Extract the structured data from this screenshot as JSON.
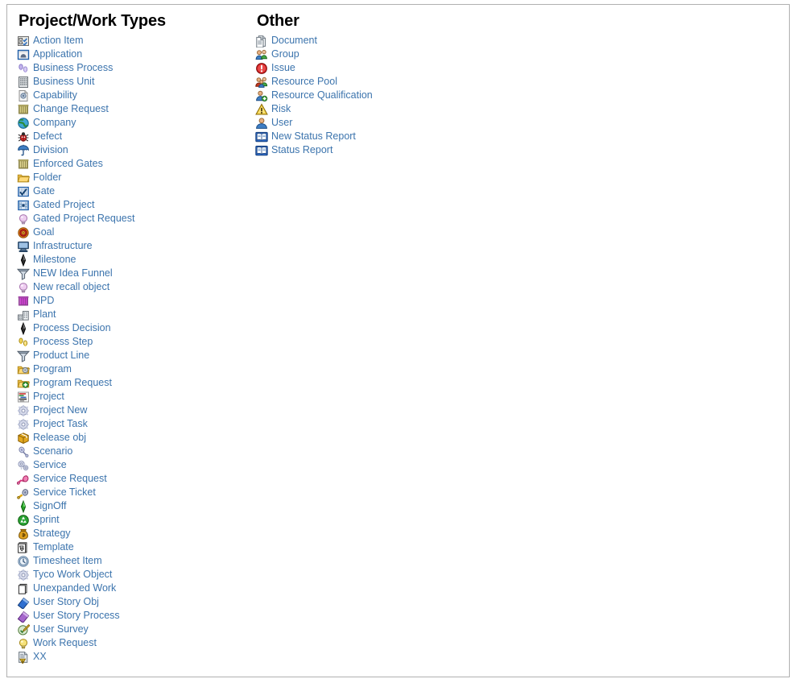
{
  "page": {
    "background": "#ffffff",
    "border_color": "#b0b0b0",
    "link_color": "#3c74ad",
    "heading_color": "#000000"
  },
  "columns": [
    {
      "id": "project-work-types",
      "heading": "Project/Work Types",
      "items": [
        {
          "label": "Action Item",
          "icon": "action-item-icon"
        },
        {
          "label": "Application",
          "icon": "application-icon"
        },
        {
          "label": "Business Process",
          "icon": "business-process-icon"
        },
        {
          "label": "Business Unit",
          "icon": "business-unit-icon"
        },
        {
          "label": "Capability",
          "icon": "capability-icon"
        },
        {
          "label": "Change Request",
          "icon": "change-request-icon"
        },
        {
          "label": "Company",
          "icon": "company-globe-icon"
        },
        {
          "label": "Defect",
          "icon": "defect-bug-icon"
        },
        {
          "label": "Division",
          "icon": "division-umbrella-icon"
        },
        {
          "label": "Enforced Gates",
          "icon": "enforced-gates-icon"
        },
        {
          "label": "Folder",
          "icon": "folder-icon"
        },
        {
          "label": "Gate",
          "icon": "gate-icon"
        },
        {
          "label": "Gated Project",
          "icon": "gated-project-icon"
        },
        {
          "label": "Gated Project Request",
          "icon": "gated-project-request-bulb-icon"
        },
        {
          "label": "Goal",
          "icon": "goal-target-icon"
        },
        {
          "label": "Infrastructure",
          "icon": "infrastructure-monitor-icon"
        },
        {
          "label": "Milestone",
          "icon": "milestone-diamond-icon"
        },
        {
          "label": "NEW Idea Funnel",
          "icon": "funnel-icon"
        },
        {
          "label": "New recall object",
          "icon": "recall-bulb-icon"
        },
        {
          "label": "NPD",
          "icon": "npd-icon"
        },
        {
          "label": "Plant",
          "icon": "plant-building-icon"
        },
        {
          "label": "Process Decision",
          "icon": "process-decision-diamond-icon"
        },
        {
          "label": "Process Step",
          "icon": "process-step-footprints-icon"
        },
        {
          "label": "Product Line",
          "icon": "product-line-funnel-icon"
        },
        {
          "label": "Program",
          "icon": "program-folder-gear-icon"
        },
        {
          "label": "Program Request",
          "icon": "program-request-folder-plus-icon"
        },
        {
          "label": "Project",
          "icon": "project-gantt-icon"
        },
        {
          "label": "Project New",
          "icon": "project-new-gear-icon"
        },
        {
          "label": "Project Task",
          "icon": "project-task-gear-icon"
        },
        {
          "label": "Release obj",
          "icon": "release-box-icon"
        },
        {
          "label": "Scenario",
          "icon": "scenario-icon"
        },
        {
          "label": "Service",
          "icon": "service-gears-icon"
        },
        {
          "label": "Service Request",
          "icon": "service-request-icon"
        },
        {
          "label": "Service Ticket",
          "icon": "service-ticket-icon"
        },
        {
          "label": "SignOff",
          "icon": "signoff-diamond-icon"
        },
        {
          "label": "Sprint",
          "icon": "sprint-recycle-icon"
        },
        {
          "label": "Strategy",
          "icon": "strategy-moneybag-icon"
        },
        {
          "label": "Template",
          "icon": "template-icon"
        },
        {
          "label": "Timesheet Item",
          "icon": "timesheet-clock-icon"
        },
        {
          "label": "Tyco Work Object",
          "icon": "tyco-work-object-gear-icon"
        },
        {
          "label": "Unexpanded Work",
          "icon": "unexpanded-work-pages-icon"
        },
        {
          "label": "User Story Obj",
          "icon": "user-story-obj-book-icon"
        },
        {
          "label": "User Story Process",
          "icon": "user-story-process-book-icon"
        },
        {
          "label": "User Survey",
          "icon": "user-survey-icon"
        },
        {
          "label": "Work Request",
          "icon": "work-request-bulb-icon"
        },
        {
          "label": "XX",
          "icon": "xx-warning-doc-icon"
        }
      ]
    },
    {
      "id": "other",
      "heading": "Other",
      "items": [
        {
          "label": "Document",
          "icon": "document-icon"
        },
        {
          "label": "Group",
          "icon": "group-users-icon"
        },
        {
          "label": "Issue",
          "icon": "issue-exclamation-icon"
        },
        {
          "label": "Resource Pool",
          "icon": "resource-pool-icon"
        },
        {
          "label": "Resource Qualification",
          "icon": "resource-qualification-icon"
        },
        {
          "label": "Risk",
          "icon": "risk-warning-icon"
        },
        {
          "label": "User",
          "icon": "user-icon"
        },
        {
          "label": "New Status Report",
          "icon": "new-status-report-book-icon"
        },
        {
          "label": "Status Report",
          "icon": "status-report-book-icon"
        }
      ]
    }
  ]
}
